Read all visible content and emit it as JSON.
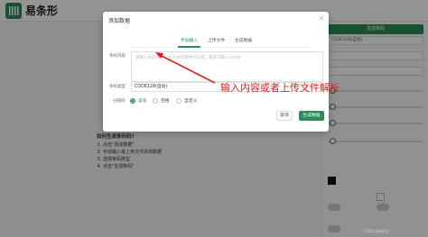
{
  "app": {
    "title": "易条形"
  },
  "right_panel": {
    "primary_button": "生成条码",
    "type_value": "CODE128(自动)"
  },
  "help": {
    "title": "如何生成条形码?",
    "steps": [
      "点击\"添加数据\"",
      "手动输入或上传文件添加数据",
      "选择条码类型",
      "点击\"生成条码\""
    ]
  },
  "modal": {
    "title": "添加数据",
    "close_icon": "×",
    "tabs": [
      "手动输入",
      "上传文件",
      "生成数据"
    ],
    "active_tab": 0,
    "content_label": "条码内容",
    "content_placeholder": "请输入条码内容，多个条码用换行分隔，最多可输入100条",
    "type_label": "条码类型",
    "type_value": "CODE128(自动)",
    "separator_label": "分隔符",
    "separators": [
      "逗号",
      "空格",
      "自定义"
    ],
    "separator_selected": 0,
    "cancel_button": "取消",
    "generate_button": "生成数据"
  },
  "annotation": {
    "text": "输入内容或者上传文件解析",
    "color": "#e02020"
  },
  "colors": {
    "accent": "#2e8b57"
  },
  "watermark": "CSDN @易条形"
}
